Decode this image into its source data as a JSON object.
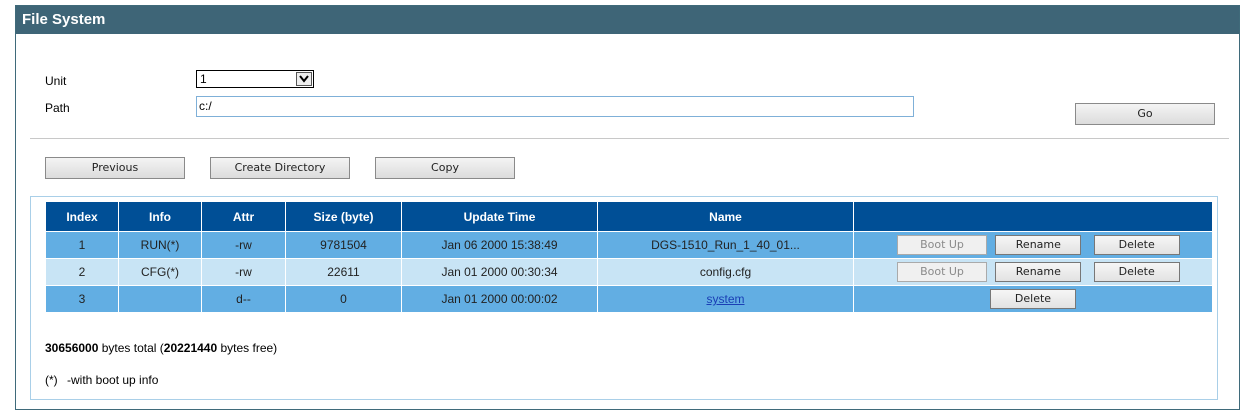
{
  "panel": {
    "title": "File System"
  },
  "form": {
    "unit_label": "Unit",
    "unit_value": "1",
    "path_label": "Path",
    "path_value": "c:/",
    "go_label": "Go"
  },
  "toolbar": {
    "previous_label": "Previous",
    "create_directory_label": "Create Directory",
    "copy_label": "Copy"
  },
  "table": {
    "headers": [
      "Index",
      "Info",
      "Attr",
      "Size (byte)",
      "Update Time",
      "Name",
      ""
    ],
    "rows": [
      {
        "index": "1",
        "info": "RUN(*)",
        "attr": "-rw",
        "size": "9781504",
        "time": "Jan 06 2000 15:38:49",
        "name": "DGS-1510_Run_1_40_01...",
        "boot_label": "Boot Up",
        "rename_label": "Rename",
        "delete_label": "Delete"
      },
      {
        "index": "2",
        "info": "CFG(*)",
        "attr": "-rw",
        "size": "22611",
        "time": "Jan 01 2000 00:30:34",
        "name": "config.cfg",
        "boot_label": "Boot Up",
        "rename_label": "Rename",
        "delete_label": "Delete"
      },
      {
        "index": "3",
        "info": "",
        "attr": "d--",
        "size": "0",
        "time": "Jan 01 2000 00:00:02",
        "name": "system",
        "delete_label": "Delete"
      }
    ]
  },
  "summary": {
    "total_bytes": "30656000",
    "total_text": " bytes total (",
    "free_bytes": "20221440",
    "free_text": " bytes free)"
  },
  "legend": {
    "marker": "(*)",
    "text": "-with boot up info"
  }
}
